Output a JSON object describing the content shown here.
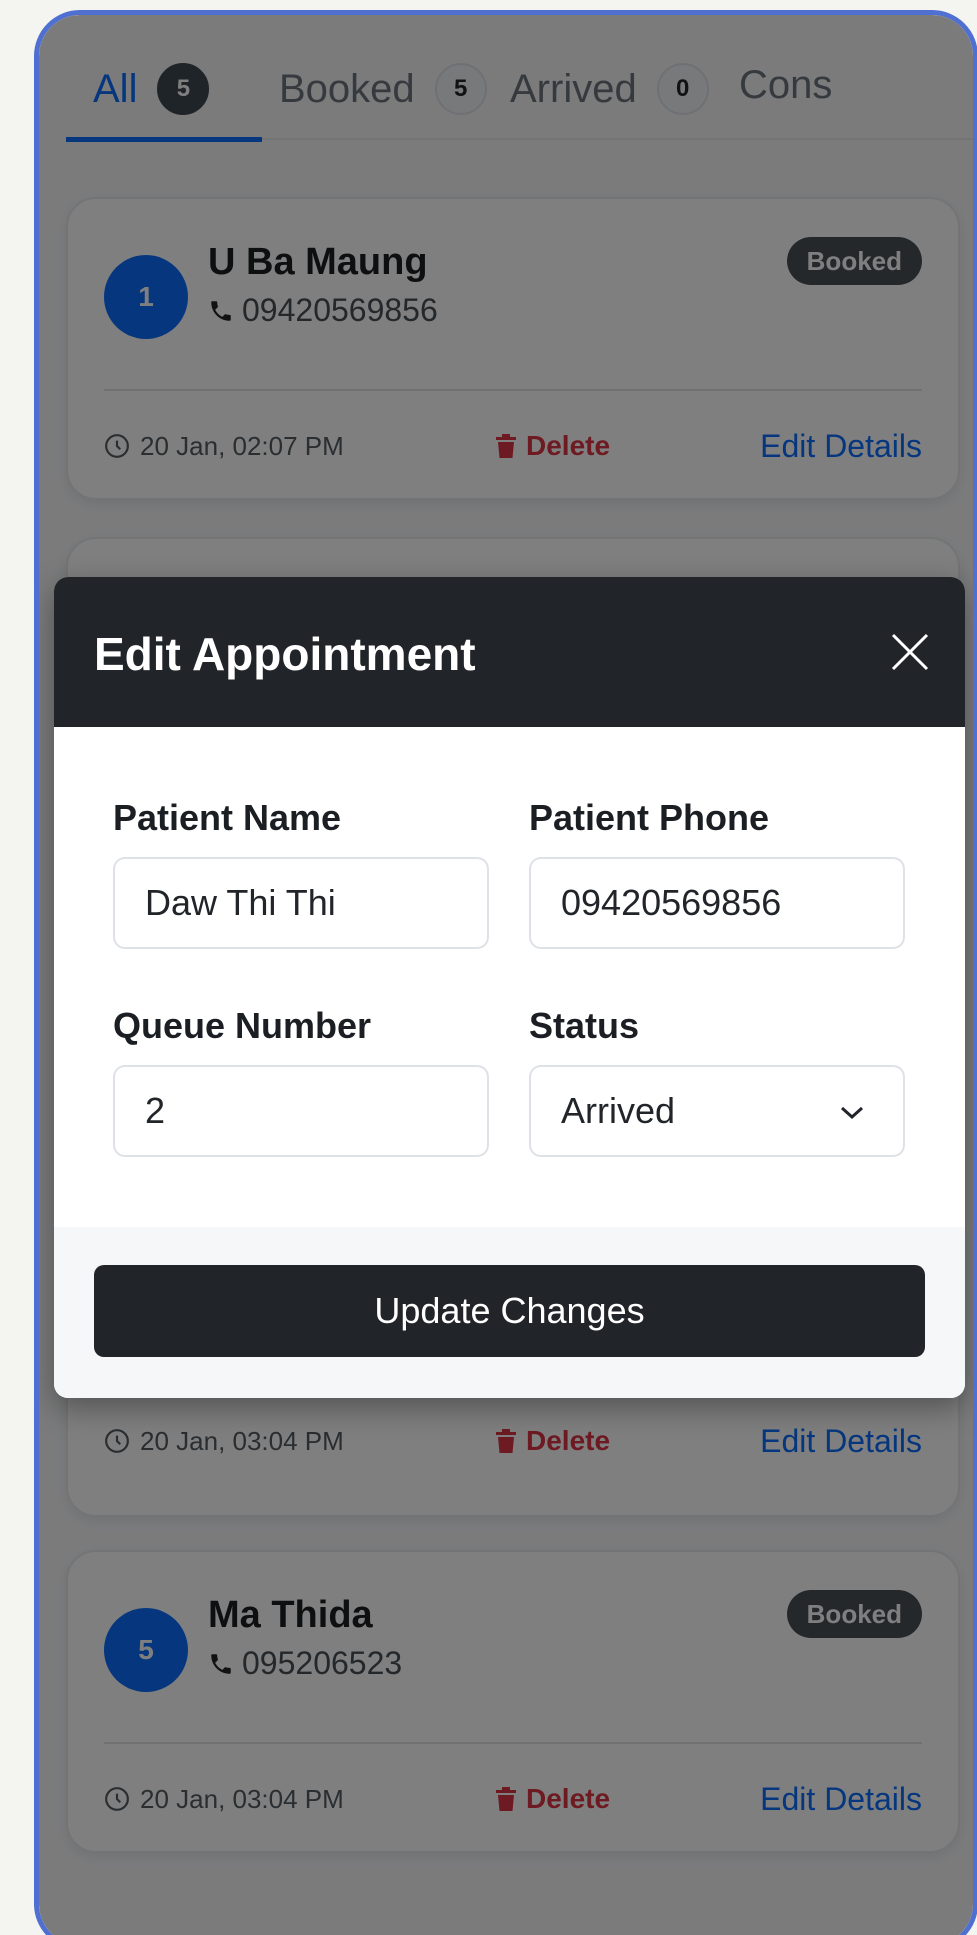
{
  "tabs": [
    {
      "label": "All",
      "count": "5"
    },
    {
      "label": "Booked",
      "count": "5"
    },
    {
      "label": "Arrived",
      "count": "0"
    },
    {
      "label": "Cons",
      "count": ""
    }
  ],
  "cards": [
    {
      "queue": "1",
      "name": "U Ba Maung",
      "phone": "09420569856",
      "status": "Booked",
      "time": "20 Jan, 02:07 PM",
      "delete_label": "Delete",
      "edit_label": "Edit Details"
    },
    {
      "time": "20 Jan, 03:04 PM",
      "delete_label": "Delete",
      "edit_label": "Edit Details"
    },
    {
      "queue": "5",
      "name": "Ma Thida",
      "phone": "095206523",
      "status": "Booked",
      "time": "20 Jan, 03:04 PM",
      "delete_label": "Delete",
      "edit_label": "Edit Details"
    }
  ],
  "modal": {
    "title": "Edit Appointment",
    "patient_name_label": "Patient Name",
    "patient_name_value": "Daw Thi Thi",
    "patient_phone_label": "Patient Phone",
    "patient_phone_value": "09420569856",
    "queue_label": "Queue Number",
    "queue_value": "2",
    "status_label": "Status",
    "status_value": "Arrived",
    "submit_label": "Update Changes"
  },
  "colors": {
    "accent": "#0d6efd",
    "danger": "#dc3545",
    "dark": "#212529",
    "frame": "#4f6fd1"
  }
}
